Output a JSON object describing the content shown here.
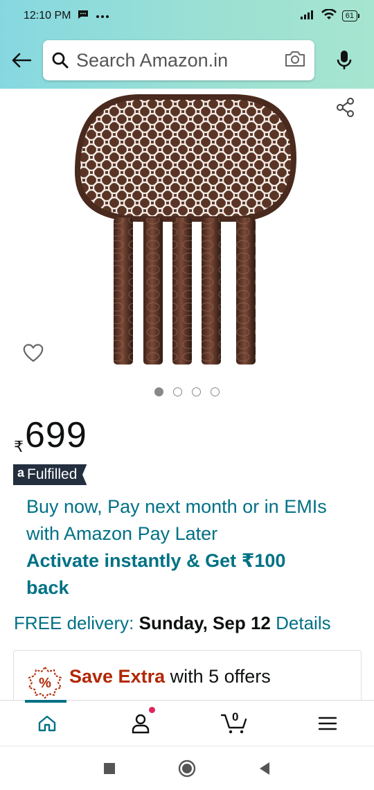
{
  "status_bar": {
    "time": "12:10 PM",
    "battery": "61",
    "icons": [
      "message-icon",
      "more-dots-icon",
      "signal-icon",
      "wifi-icon",
      "battery-icon"
    ]
  },
  "header": {
    "back_icon": "back-arrow-icon",
    "search_placeholder": "Search Amazon.in",
    "camera_icon": "camera-icon",
    "mic_icon": "microphone-icon",
    "background_color": "#9be0d4"
  },
  "product": {
    "image_pages": 4,
    "active_page": 1,
    "share_icon": "share-icon",
    "wishlist_icon": "heart-icon",
    "currency_symbol": "₹",
    "price": "699",
    "fulfilled_logo": "a",
    "fulfilled_label": "Fulfilled"
  },
  "paylater": {
    "line1": "Buy now, Pay next month or in EMIs with Amazon Pay Later",
    "line2": "Activate instantly & Get ₹100 back"
  },
  "delivery": {
    "prefix": "FREE delivery:",
    "date": "Sunday, Sep 12",
    "details_link": "Details"
  },
  "offers": {
    "icon": "discount-badge-icon",
    "highlight": "Save Extra",
    "rest": "with 5 offers"
  },
  "bottom_nav": {
    "items": [
      {
        "icon": "home-icon",
        "active": true
      },
      {
        "icon": "account-icon",
        "active": false
      },
      {
        "icon": "cart-icon",
        "cart_count": "0",
        "active": false
      },
      {
        "icon": "menu-icon",
        "active": false
      }
    ],
    "accent": "#007185"
  },
  "system_nav": [
    "recents-square-icon",
    "home-circle-icon",
    "back-triangle-icon"
  ],
  "colors": {
    "link_teal": "#007185",
    "save_red": "#b12704",
    "fulfilled_bg": "#232f3e"
  }
}
